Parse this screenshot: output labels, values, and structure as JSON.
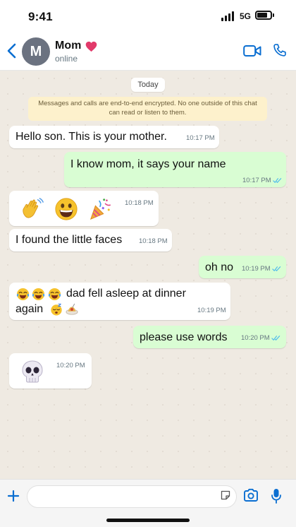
{
  "status_bar": {
    "time": "9:41",
    "network": "5G"
  },
  "header": {
    "avatar_letter": "M",
    "contact_name": "Mom",
    "contact_status": "online"
  },
  "chat": {
    "date_label": "Today",
    "encryption_notice": "Messages and calls are end-to-end encrypted. No one outside of this chat can read or listen to them.",
    "messages": [
      {
        "direction": "incoming",
        "text": "Hello son. This is your mother.",
        "time": "10:17 PM"
      },
      {
        "direction": "outgoing",
        "text": "I know mom, it says your name",
        "time": "10:17 PM",
        "read": true
      },
      {
        "direction": "incoming",
        "emojis": [
          "waving-hand",
          "grinning-face",
          "party-popper"
        ],
        "time": "10:18 PM"
      },
      {
        "direction": "incoming",
        "text": "I found the little faces",
        "time": "10:18 PM"
      },
      {
        "direction": "outgoing",
        "text": "oh no",
        "time": "10:19 PM",
        "read": true
      },
      {
        "direction": "incoming",
        "text_line1": "dad fell asleep at dinner",
        "text_line2": "again",
        "leading_emojis": [
          "tears-of-joy",
          "tears-of-joy",
          "tears-of-joy"
        ],
        "trailing_emojis": [
          "sleeping-face",
          "spaghetti"
        ],
        "time": "10:19 PM"
      },
      {
        "direction": "outgoing",
        "text": "please use words",
        "time": "10:20 PM",
        "read": true
      },
      {
        "direction": "incoming",
        "emojis": [
          "skull"
        ],
        "time": "10:20 PM"
      }
    ]
  },
  "composer": {
    "placeholder": ""
  },
  "colors": {
    "accent": "#0a6ed1",
    "outgoing_bubble": "#d9fdd3",
    "incoming_bubble": "#ffffff",
    "chat_background": "#efeae2",
    "read_ticks": "#53bdeb",
    "notice_background": "#fdf1cc"
  }
}
